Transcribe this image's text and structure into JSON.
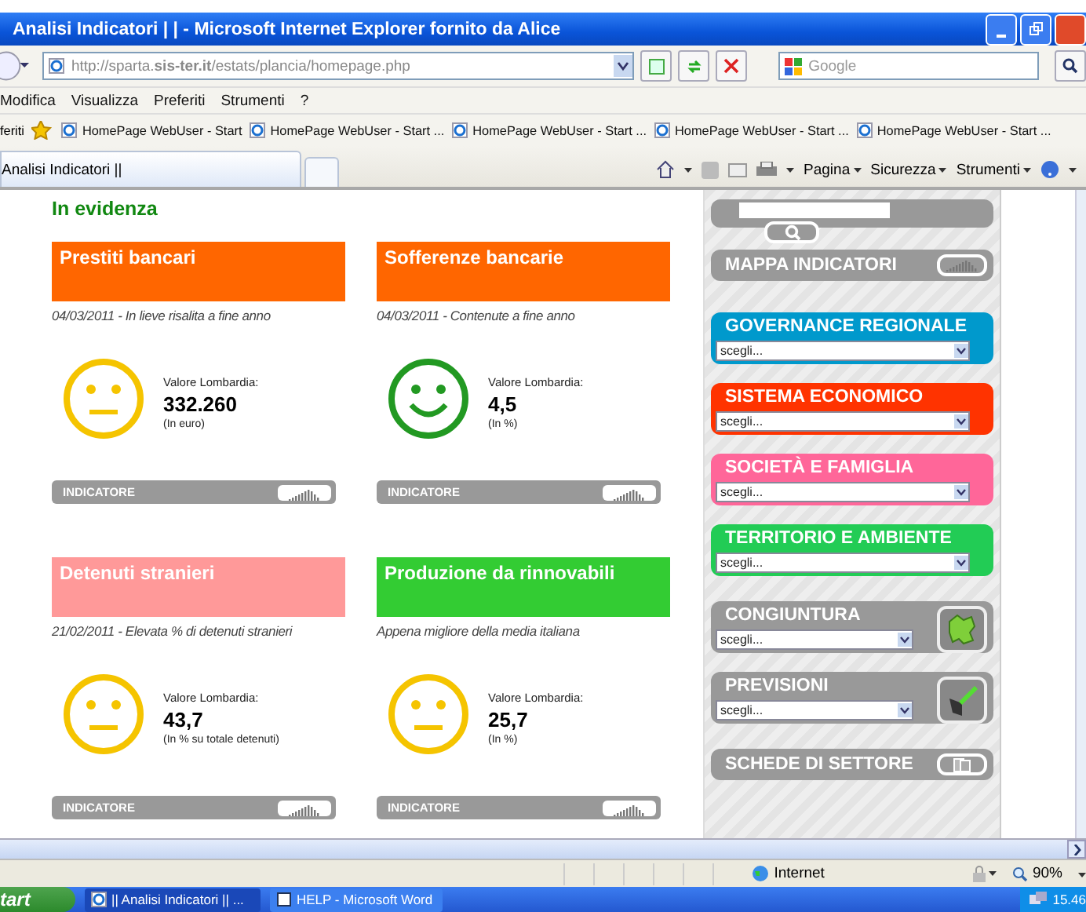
{
  "window": {
    "title": "Analisi Indicatori | | - Microsoft Internet Explorer fornito da Alice"
  },
  "address_bar": {
    "url": "http://sparta.**sis-ter.it**/estats/plancia/homepage.php",
    "search_placeholder": "Google"
  },
  "menu": [
    "Modifica",
    "Visualizza",
    "Preferiti",
    "Strumenti",
    "?"
  ],
  "favorites_bar": {
    "label": "feriti",
    "links": [
      "HomePage WebUser - Start",
      "HomePage WebUser - Start ...",
      "HomePage WebUser - Start ...",
      "HomePage WebUser - Start ...",
      "HomePage WebUser - Start ..."
    ]
  },
  "tabs": [
    {
      "label": "Analisi Indicatori ||",
      "selected": true
    }
  ],
  "command_bar": [
    "Pagina",
    "Sicurezza",
    "Strumenti"
  ],
  "page": {
    "heading": "In evidenza",
    "cards": [
      {
        "title": "Prestiti bancari",
        "color": "#ff6600",
        "note": "04/03/2011 - In lieve risalita a fine anno",
        "kind": "neutral",
        "value_label": "Valore Lombardia:",
        "value": "332.260",
        "unit": "(In euro)",
        "button": "INDICATORE"
      },
      {
        "title": "Sofferenze bancarie",
        "color": "#ff6600",
        "note": "04/03/2011 - Contenute a fine anno",
        "kind": "happy",
        "value_label": "Valore Lombardia:",
        "value": "4,5",
        "unit": "(In %)",
        "button": "INDICATORE"
      },
      {
        "title": "Detenuti stranieri",
        "color": "#ff9999",
        "note": "21/02/2011 - Elevata % di detenuti stranieri",
        "kind": "neutral",
        "value_label": "Valore Lombardia:",
        "value": "43,7",
        "unit": "(In % su totale detenuti)",
        "button": "INDICATORE"
      },
      {
        "title": "Produzione da rinnovabili",
        "color": "#33cc33",
        "note": "Appena migliore della media italiana",
        "kind": "neutral",
        "value_label": "Valore Lombardia:",
        "value": "25,7",
        "unit": "(In %)",
        "button": "INDICATORE"
      }
    ]
  },
  "sidebar": [
    {
      "kind": "search"
    },
    {
      "kind": "chart-link",
      "label": "MAPPA INDICATORI"
    },
    {
      "kind": "category",
      "label": "GOVERNANCE REGIONALE",
      "color": "#0099cc",
      "select": "scegli..."
    },
    {
      "kind": "category",
      "label": "SISTEMA ECONOMICO",
      "color": "#ff3300",
      "select": "scegli..."
    },
    {
      "kind": "category",
      "label": "SOCIETÀ E FAMIGLIA",
      "color": "#ff6699",
      "select": "scegli..."
    },
    {
      "kind": "category",
      "label": "TERRITORIO E AMBIENTE",
      "color": "#22cc55",
      "select": "scegli..."
    },
    {
      "kind": "map-tool",
      "label": "CONGIUNTURA",
      "select": "scegli..."
    },
    {
      "kind": "pen-tool",
      "label": "PREVISIONI",
      "select": "scegli..."
    },
    {
      "kind": "files-link",
      "label": "SCHEDE DI SETTORE"
    }
  ],
  "status_bar": {
    "zone": "Internet",
    "zoom": "90%"
  },
  "taskbar": {
    "start": "tart",
    "tasks": [
      {
        "label": "|| Analisi Indicatori || ...",
        "selected": true
      },
      {
        "label": "HELP - Microsoft Word",
        "selected": false
      }
    ],
    "clock": "15.46"
  }
}
